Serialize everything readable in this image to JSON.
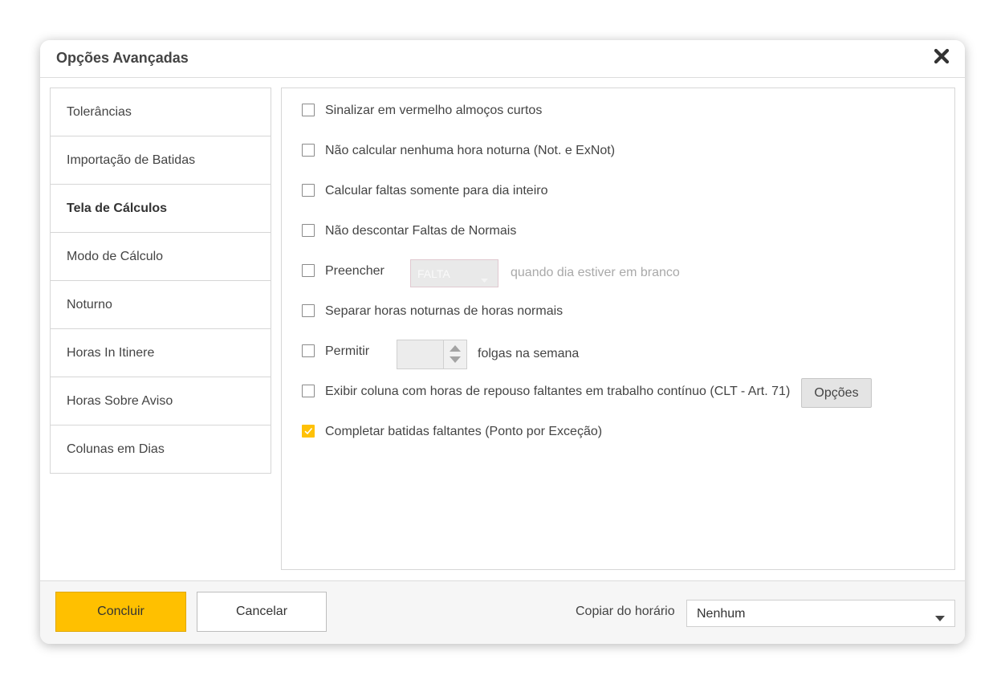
{
  "dialog": {
    "title": "Opções Avançadas",
    "close_icon": "close-icon"
  },
  "sidebar": {
    "items": [
      {
        "label": "Tolerâncias",
        "active": false
      },
      {
        "label": "Importação de Batidas",
        "active": false
      },
      {
        "label": "Tela de Cálculos",
        "active": true
      },
      {
        "label": "Modo de Cálculo",
        "active": false
      },
      {
        "label": "Noturno",
        "active": false
      },
      {
        "label": "Horas In Itinere",
        "active": false
      },
      {
        "label": "Horas Sobre Aviso",
        "active": false
      },
      {
        "label": "Colunas em Dias",
        "active": false
      }
    ]
  },
  "options": {
    "short_lunch": {
      "label": "Sinalizar em vermelho almoços curtos",
      "checked": false
    },
    "no_night": {
      "label": "Não calcular nenhuma hora noturna (Not. e ExNot)",
      "checked": false
    },
    "full_day_absence": {
      "label": "Calcular faltas somente para dia inteiro",
      "checked": false
    },
    "no_discount": {
      "label": "Não descontar Faltas de Normais",
      "checked": false
    },
    "fill": {
      "label": "Preencher",
      "select_value": "FALTA",
      "suffix": "quando dia estiver em branco",
      "checked": false
    },
    "separate_night": {
      "label": "Separar horas noturnas de horas normais",
      "checked": false
    },
    "allow": {
      "label": "Permitir",
      "spinner_value": "",
      "suffix": "folgas na semana",
      "checked": false
    },
    "rest_column": {
      "label": "Exibir coluna com horas de repouso faltantes em trabalho contínuo (CLT - Art. 71)",
      "button": "Opções",
      "checked": false
    },
    "complete_punches": {
      "label": "Completar batidas faltantes (Ponto por Exceção)",
      "checked": true
    }
  },
  "footer": {
    "confirm": "Concluir",
    "cancel": "Cancelar",
    "copy_label": "Copiar do horário",
    "copy_value": "Nenhum"
  },
  "colors": {
    "accent": "#ffc000",
    "checkbox_checked": "#ffc107"
  }
}
